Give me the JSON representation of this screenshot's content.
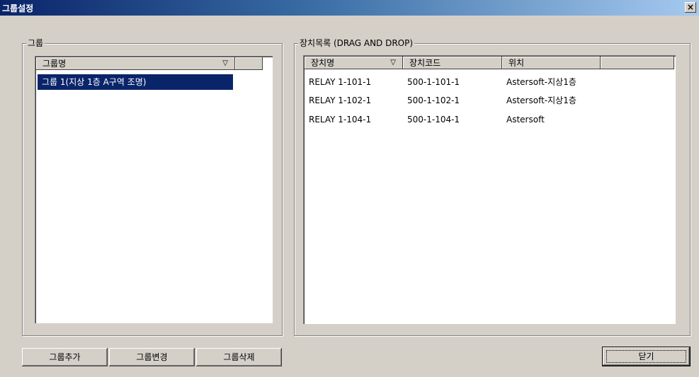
{
  "window": {
    "title": "그룹설정",
    "close_glyph": "×"
  },
  "group_panel": {
    "title": "그룹",
    "header": {
      "name_col": "그룹명",
      "sort_glyph": "▽"
    },
    "rows": [
      {
        "name": "그룹 1(지상 1층 A구역 조명)",
        "selected": true
      }
    ]
  },
  "device_panel": {
    "title": "장치목록 (DRAG AND DROP)",
    "headers": {
      "name": "장치명",
      "code": "장치코드",
      "location": "위치",
      "sort_glyph": "▽"
    },
    "rows": [
      {
        "name": "RELAY 1-101-1",
        "code": "500-1-101-1",
        "location": "Astersoft-지상1층"
      },
      {
        "name": "RELAY 1-102-1",
        "code": "500-1-102-1",
        "location": "Astersoft-지상1층"
      },
      {
        "name": "RELAY 1-104-1",
        "code": "500-1-104-1",
        "location": "Astersoft"
      }
    ]
  },
  "buttons": {
    "add": "그룹추가",
    "edit": "그룹변경",
    "delete": "그룹삭제",
    "close": "닫기"
  }
}
